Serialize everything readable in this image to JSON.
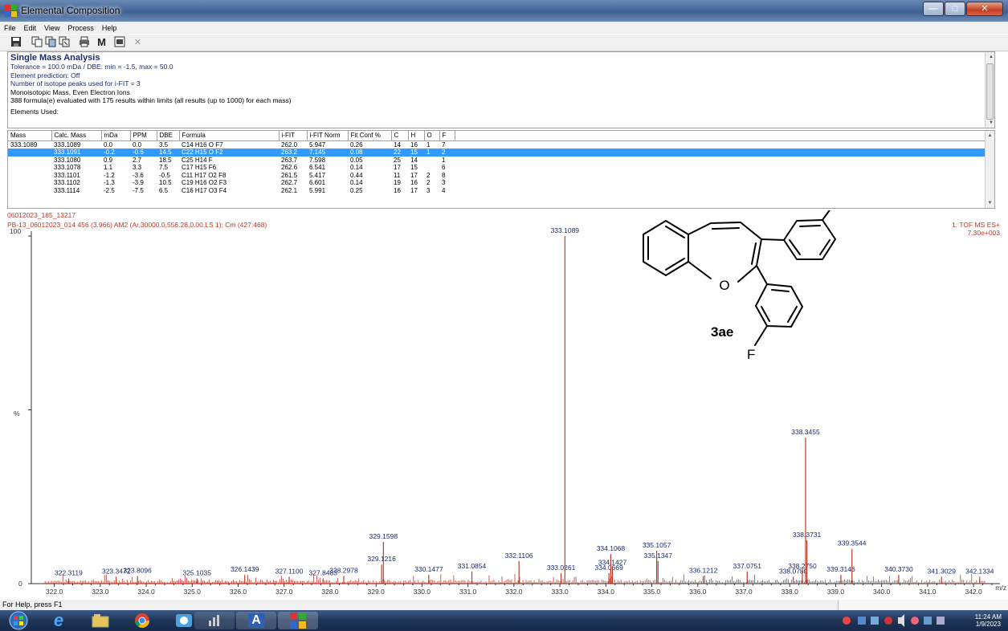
{
  "window": {
    "title": "Elemental Composition",
    "buttons": {
      "min": "—",
      "max": "□",
      "close": "✕"
    }
  },
  "menu": [
    "File",
    "Edit",
    "View",
    "Process",
    "Help"
  ],
  "toolbar": {
    "icons": [
      "save-icon",
      "copy-icon",
      "copy-picture-icon",
      "copy-metafile-icon",
      "print-icon",
      "mass-m-icon",
      "list-view-icon",
      "close-doc-icon"
    ],
    "m_label": "M"
  },
  "summary": {
    "title": "Single Mass Analysis",
    "lines": [
      "Tolerance = 100.0 mDa  /  DBE: min = -1.5, max = 50.0",
      "Element prediction: Off",
      "Number of isotope peaks used for i-FIT = 3"
    ],
    "lines2": [
      "Monoisotopic Mass, Even Electron Ions",
      "388 formula(e) evaluated with 175 results within limits (all results (up to 1000) for each mass)",
      "Elements Used:"
    ]
  },
  "table": {
    "columns": [
      "Mass",
      "Calc. Mass",
      "mDa",
      "PPM",
      "DBE",
      "Formula",
      "i-FIT",
      "i-FIT Norm",
      "Fit Conf %",
      "C",
      "H",
      "O",
      "F"
    ],
    "rows": [
      [
        "333.1089",
        "333.1089",
        "0.0",
        "0.0",
        "3.5",
        "C14 H16 O F7",
        "262.0",
        "5.947",
        "0.26",
        "14",
        "16",
        "1",
        "7"
      ],
      [
        "",
        "333.1091",
        "-0.2",
        "-0.6",
        "14.5",
        "C22 H15 O F2",
        "263.2",
        "7.145",
        "0.08",
        "22",
        "15",
        "1",
        "2"
      ],
      [
        "",
        "333.1080",
        "0.9",
        "2.7",
        "18.5",
        "C25 H14 F",
        "263.7",
        "7.598",
        "0.05",
        "25",
        "14",
        "",
        "1"
      ],
      [
        "",
        "333.1078",
        "1.1",
        "3.3",
        "7.5",
        "C17 H15 F6",
        "262.6",
        "6.541",
        "0.14",
        "17",
        "15",
        "",
        "6"
      ],
      [
        "",
        "333.1101",
        "-1.2",
        "-3.6",
        "-0.5",
        "C11 H17 O2 F8",
        "261.5",
        "5.417",
        "0.44",
        "11",
        "17",
        "2",
        "8"
      ],
      [
        "",
        "333.1102",
        "-1.3",
        "-3.9",
        "10.5",
        "C19 H16 O2 F3",
        "262.7",
        "6.601",
        "0.14",
        "19",
        "16",
        "2",
        "3"
      ],
      [
        "",
        "333.1114",
        "-2.5",
        "-7.5",
        "6.5",
        "C16 H17 O3 F4",
        "262.1",
        "5.991",
        "0.25",
        "16",
        "17",
        "3",
        "4"
      ]
    ],
    "selected_row": 1
  },
  "spectrum": {
    "header1": "06012023_185_13217",
    "header2": "PB-13_06012023_014 456 (3.966) AM2 (Ar,30000.0,556.28,0.00,LS 1); Cm (427:468)",
    "instrument": "1: TOF MS ES+",
    "intensity": "7.30e+003",
    "y_labels": [
      "100",
      "%",
      "0"
    ],
    "x_unit": "m/z",
    "compound_label": "3ae",
    "atoms": {
      "f1": "F",
      "f2": "F",
      "o": "O"
    }
  },
  "chart_data": {
    "type": "bar",
    "title": "",
    "xlabel": "m/z",
    "ylabel": "%",
    "xlim": [
      321.5,
      342.4
    ],
    "ylim": [
      0,
      100
    ],
    "x_ticks": [
      "322.0",
      "323.0",
      "324.0",
      "325.0",
      "326.0",
      "327.0",
      "328.0",
      "329.0",
      "330.0",
      "331.0",
      "332.0",
      "333.0",
      "334.0",
      "335.0",
      "336.0",
      "337.0",
      "338.0",
      "339.0",
      "340.0",
      "341.0",
      "342.0"
    ],
    "peaks": [
      {
        "mz": 322.3119,
        "rel": 1.5,
        "label": "322.3119"
      },
      {
        "mz": 323.3472,
        "rel": 2.0,
        "label": "323.3472"
      },
      {
        "mz": 323.8096,
        "rel": 2.2,
        "label": "323.8096"
      },
      {
        "mz": 325.1035,
        "rel": 1.5,
        "label": "325.1035"
      },
      {
        "mz": 326.1439,
        "rel": 2.5,
        "label": "326.1439"
      },
      {
        "mz": 327.11,
        "rel": 2.0,
        "label": "327.1100"
      },
      {
        "mz": 327.8483,
        "rel": 1.5,
        "label": "327.8483"
      },
      {
        "mz": 328.2978,
        "rel": 2.2,
        "label": "328.2978"
      },
      {
        "mz": 329.1216,
        "rel": 5.5,
        "label": "329.1216"
      },
      {
        "mz": 329.1598,
        "rel": 12.0,
        "label": "329.1598"
      },
      {
        "mz": 330.1477,
        "rel": 2.5,
        "label": "330.1477"
      },
      {
        "mz": 331.0854,
        "rel": 3.5,
        "label": "331.0854"
      },
      {
        "mz": 332.1106,
        "rel": 6.5,
        "label": "332.1106"
      },
      {
        "mz": 333.0261,
        "rel": 3.0,
        "label": "333.0261"
      },
      {
        "mz": 333.1089,
        "rel": 100,
        "label": "333.1089"
      },
      {
        "mz": 334.0669,
        "rel": 3.0,
        "label": "334.0669"
      },
      {
        "mz": 334.1068,
        "rel": 8.5,
        "label": "334.1068"
      },
      {
        "mz": 334.1427,
        "rel": 4.5,
        "label": "334.1427"
      },
      {
        "mz": 335.1057,
        "rel": 9.5,
        "label": "335.1057"
      },
      {
        "mz": 335.1347,
        "rel": 6.5,
        "label": "335.1347"
      },
      {
        "mz": 336.1212,
        "rel": 2.2,
        "label": "336.1212"
      },
      {
        "mz": 337.0751,
        "rel": 3.5,
        "label": "337.0751"
      },
      {
        "mz": 338.078,
        "rel": 2.0,
        "label": "338.0780"
      },
      {
        "mz": 338.275,
        "rel": 3.5,
        "label": "338.2750"
      },
      {
        "mz": 338.3455,
        "rel": 42,
        "label": "338.3455"
      },
      {
        "mz": 338.3731,
        "rel": 12.5,
        "label": "338.3731"
      },
      {
        "mz": 339.1146,
        "rel": 2.5,
        "label": "339.3146"
      },
      {
        "mz": 339.3544,
        "rel": 10.0,
        "label": "339.3544"
      },
      {
        "mz": 340.373,
        "rel": 2.5,
        "label": "340.3730"
      },
      {
        "mz": 341.3029,
        "rel": 2.0,
        "label": "341.3029"
      },
      {
        "mz": 342.1334,
        "rel": 2.0,
        "label": "342.1334"
      }
    ]
  },
  "statusbar": {
    "text": "For Help, press F1"
  },
  "taskbar": {
    "apps": [
      "start-orb-icon",
      "ie-icon",
      "explorer-icon",
      "chrome-icon",
      "media-icon",
      "sound-icon",
      "word-a-icon",
      "masslynx-icon"
    ],
    "time": "11:24 AM",
    "date": "1/9/2023"
  },
  "colors": {
    "selection": "#3399ff",
    "spectrum": "#c0392b",
    "title_blue": "#1a2a6e"
  }
}
